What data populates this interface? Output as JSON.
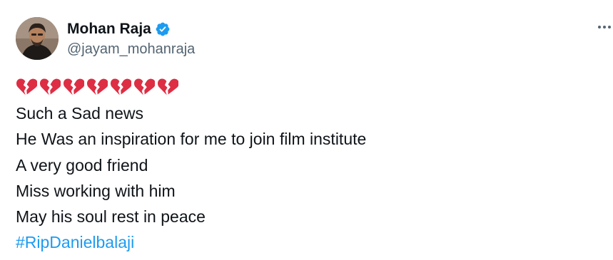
{
  "author": {
    "display_name": "Mohan Raja",
    "handle": "@jayam_mohanraja",
    "verified": true,
    "avatar_icon": "user-avatar"
  },
  "more_menu_icon": "more-horizontal-icon",
  "tweet": {
    "emoji": [
      "💔",
      "💔",
      "💔",
      "💔",
      "💔",
      "💔",
      "💔"
    ],
    "lines": [
      "Such a Sad news",
      "He Was an inspiration for me to join film institute",
      "A very good friend",
      "Miss working with him",
      "May his soul rest in peace"
    ],
    "hashtag": "#RipDanielbalaji"
  },
  "colors": {
    "text": "#0f1419",
    "secondary": "#536471",
    "accent": "#1d9bf0",
    "heart": "#dd2e44"
  }
}
